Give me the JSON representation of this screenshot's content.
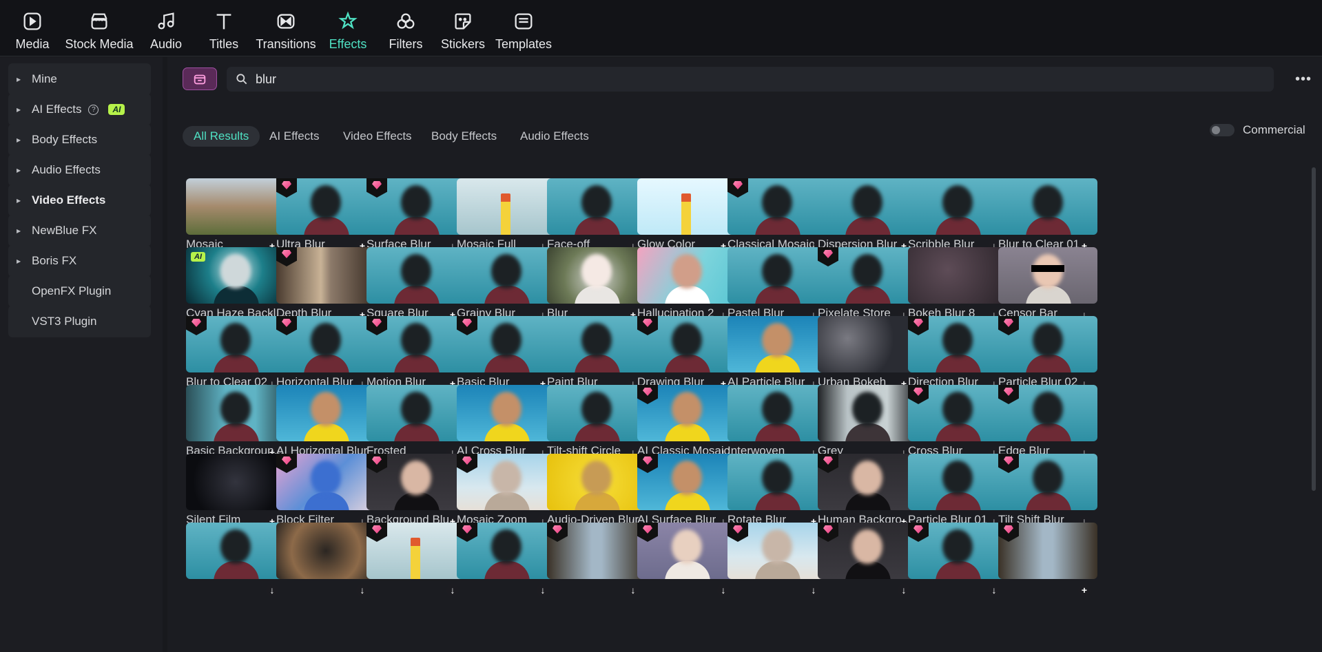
{
  "toolbar": [
    {
      "id": "media",
      "label": "Media",
      "icon": "media-icon"
    },
    {
      "id": "stock-media",
      "label": "Stock Media",
      "icon": "stock-media-icon"
    },
    {
      "id": "audio",
      "label": "Audio",
      "icon": "music-note-icon"
    },
    {
      "id": "titles",
      "label": "Titles",
      "icon": "text-t-icon"
    },
    {
      "id": "transitions",
      "label": "Transitions",
      "icon": "transitions-icon"
    },
    {
      "id": "effects",
      "label": "Effects",
      "icon": "effects-star-icon",
      "active": true
    },
    {
      "id": "filters",
      "label": "Filters",
      "icon": "filters-icon"
    },
    {
      "id": "stickers",
      "label": "Stickers",
      "icon": "sticker-icon"
    },
    {
      "id": "templates",
      "label": "Templates",
      "icon": "templates-icon"
    }
  ],
  "sidebar": [
    {
      "label": "Mine",
      "caret": true
    },
    {
      "label": "AI Effects",
      "caret": true,
      "help": true,
      "badge": "AI"
    },
    {
      "label": "Body Effects",
      "caret": true
    },
    {
      "label": "Audio Effects",
      "caret": true
    },
    {
      "label": "Video Effects",
      "caret": true,
      "bold": true
    },
    {
      "label": "NewBlue FX",
      "caret": true
    },
    {
      "label": "Boris FX",
      "caret": true
    },
    {
      "label": "OpenFX Plugin",
      "caret": false
    },
    {
      "label": "VST3 Plugin",
      "caret": false
    }
  ],
  "search": {
    "value": "blur",
    "more_label": "•••"
  },
  "filter_tabs": [
    {
      "label": "All Results",
      "active": true
    },
    {
      "label": "AI Effects"
    },
    {
      "label": "Video Effects"
    },
    {
      "label": "Body Effects"
    },
    {
      "label": "Audio Effects"
    }
  ],
  "commercial": {
    "label": "Commercial",
    "on": false
  },
  "colors": {
    "accent": "#4fe1c3",
    "ai_badge": "#b6f24a",
    "premium": "#e83a7e"
  },
  "effects": [
    {
      "label": "Mosaic",
      "thumb": "vineyard",
      "action": "+",
      "premium": false
    },
    {
      "label": "Ultra Blur",
      "thumb": "woman",
      "action": "+",
      "premium": true
    },
    {
      "label": "Surface Blur",
      "thumb": "woman",
      "action": "↓",
      "premium": true
    },
    {
      "label": "Mosaic Full",
      "thumb": "lighthouse",
      "action": "↓",
      "premium": false
    },
    {
      "label": "Face-off",
      "thumb": "woman",
      "action": "↓",
      "premium": false
    },
    {
      "label": "Glow Color",
      "thumb": "lighthouse-bright",
      "action": "+",
      "premium": false
    },
    {
      "label": "Classical Mosaic",
      "thumb": "woman",
      "action": "↓",
      "premium": true
    },
    {
      "label": "Dispersion Blur",
      "thumb": "woman",
      "action": "+",
      "premium": false
    },
    {
      "label": "Scribble Blur",
      "thumb": "woman",
      "action": "↓",
      "premium": false
    },
    {
      "label": "Blur to Clear 01",
      "thumb": "woman",
      "action": "+",
      "premium": false
    },
    {
      "label": "Cyan Haze Backl...",
      "thumb": "cyan-man",
      "action": "↓",
      "premium": false,
      "ai": true
    },
    {
      "label": "Depth Blur",
      "thumb": "street",
      "action": "+",
      "premium": true
    },
    {
      "label": "Square Blur",
      "thumb": "woman",
      "action": "+",
      "premium": false
    },
    {
      "label": "Grainy Blur",
      "thumb": "woman",
      "action": "↓",
      "premium": false
    },
    {
      "label": "Blur",
      "thumb": "road",
      "action": "+",
      "premium": false
    },
    {
      "label": "Hallucination 2",
      "thumb": "pink-woman",
      "action": "↓",
      "premium": false
    },
    {
      "label": "Pastel Blur",
      "thumb": "woman",
      "action": "↓",
      "premium": false
    },
    {
      "label": "Pixelate Store",
      "thumb": "woman",
      "action": "↓",
      "premium": true
    },
    {
      "label": "Bokeh Blur 8",
      "thumb": "dark",
      "action": "↓",
      "premium": false
    },
    {
      "label": "Censor Bar",
      "thumb": "censor",
      "action": "↓",
      "premium": false
    },
    {
      "label": "Blur to Clear 02",
      "thumb": "woman",
      "action": "↓",
      "premium": true
    },
    {
      "label": "Horizontal Blur",
      "thumb": "woman",
      "action": "↓",
      "premium": true
    },
    {
      "label": "Motion Blur",
      "thumb": "woman",
      "action": "+",
      "premium": true
    },
    {
      "label": "Basic Blur",
      "thumb": "woman",
      "action": "+",
      "premium": true
    },
    {
      "label": "Paint Blur",
      "thumb": "woman",
      "action": "↓",
      "premium": false
    },
    {
      "label": "Drawing Blur",
      "thumb": "woman",
      "action": "+",
      "premium": true
    },
    {
      "label": "AI Particle Blur",
      "thumb": "yellow-woman",
      "action": "↓",
      "premium": false
    },
    {
      "label": "Urban Bokeh",
      "thumb": "bokeh",
      "action": "+",
      "premium": false
    },
    {
      "label": "Direction Blur",
      "thumb": "woman",
      "action": "↓",
      "premium": true
    },
    {
      "label": "Particle Blur 02",
      "thumb": "woman",
      "action": "↓",
      "premium": true
    },
    {
      "label": "Basic Backgroun...",
      "thumb": "woman-frame",
      "action": "+",
      "premium": false
    },
    {
      "label": "AI Horizontal Blur",
      "thumb": "yellow-woman",
      "action": "↓",
      "premium": false
    },
    {
      "label": "Frosted",
      "thumb": "woman",
      "action": "↓",
      "premium": false
    },
    {
      "label": "AI Cross Blur",
      "thumb": "yellow-woman",
      "action": "↓",
      "premium": false
    },
    {
      "label": "Tilt-shift Circle",
      "thumb": "woman",
      "action": "↓",
      "premium": false
    },
    {
      "label": "AI Classic Mosaic",
      "thumb": "yellow-woman",
      "action": "↓",
      "premium": true
    },
    {
      "label": "Interwoven",
      "thumb": "woman",
      "action": "↓",
      "premium": false
    },
    {
      "label": "Grey",
      "thumb": "grey-woman",
      "action": "↓",
      "premium": false
    },
    {
      "label": "Cross Blur",
      "thumb": "woman",
      "action": "↓",
      "premium": true
    },
    {
      "label": "Edge Blur",
      "thumb": "woman",
      "action": "↓",
      "premium": true
    },
    {
      "label": "Silent Film",
      "thumb": "black",
      "action": "+",
      "premium": false
    },
    {
      "label": "Block Filter",
      "thumb": "colorful",
      "action": "↓",
      "premium": true
    },
    {
      "label": "Background Blu...",
      "thumb": "dancer",
      "action": "+",
      "premium": true
    },
    {
      "label": "Mosaic Zoom",
      "thumb": "beach",
      "action": "↓",
      "premium": true
    },
    {
      "label": "Audio-Driven Blur",
      "thumb": "yellow",
      "action": "↓",
      "premium": false
    },
    {
      "label": "AI Surface Blur",
      "thumb": "yellow-woman",
      "action": "↓",
      "premium": true
    },
    {
      "label": "Rotate Blur",
      "thumb": "woman",
      "action": "+",
      "premium": false
    },
    {
      "label": "Human Backgro...",
      "thumb": "dancer",
      "action": "+",
      "premium": true
    },
    {
      "label": "Particle Blur 01",
      "thumb": "woman",
      "action": "↓",
      "premium": false
    },
    {
      "label": "Tilt Shift Blur",
      "thumb": "woman",
      "action": "↓",
      "premium": true
    },
    {
      "label": "",
      "thumb": "woman",
      "action": "↓",
      "premium": false
    },
    {
      "label": "",
      "thumb": "warm",
      "action": "↓",
      "premium": false
    },
    {
      "label": "",
      "thumb": "lighthouse",
      "action": "↓",
      "premium": true
    },
    {
      "label": "",
      "thumb": "woman",
      "action": "↓",
      "premium": true
    },
    {
      "label": "",
      "thumb": "city",
      "action": "↓",
      "premium": true
    },
    {
      "label": "",
      "thumb": "smile",
      "action": "↓",
      "premium": true
    },
    {
      "label": "",
      "thumb": "beach",
      "action": "↓",
      "premium": true
    },
    {
      "label": "",
      "thumb": "dancer",
      "action": "↓",
      "premium": true
    },
    {
      "label": "",
      "thumb": "woman",
      "action": "↓",
      "premium": true
    },
    {
      "label": "",
      "thumb": "city",
      "action": "+",
      "premium": true
    }
  ]
}
